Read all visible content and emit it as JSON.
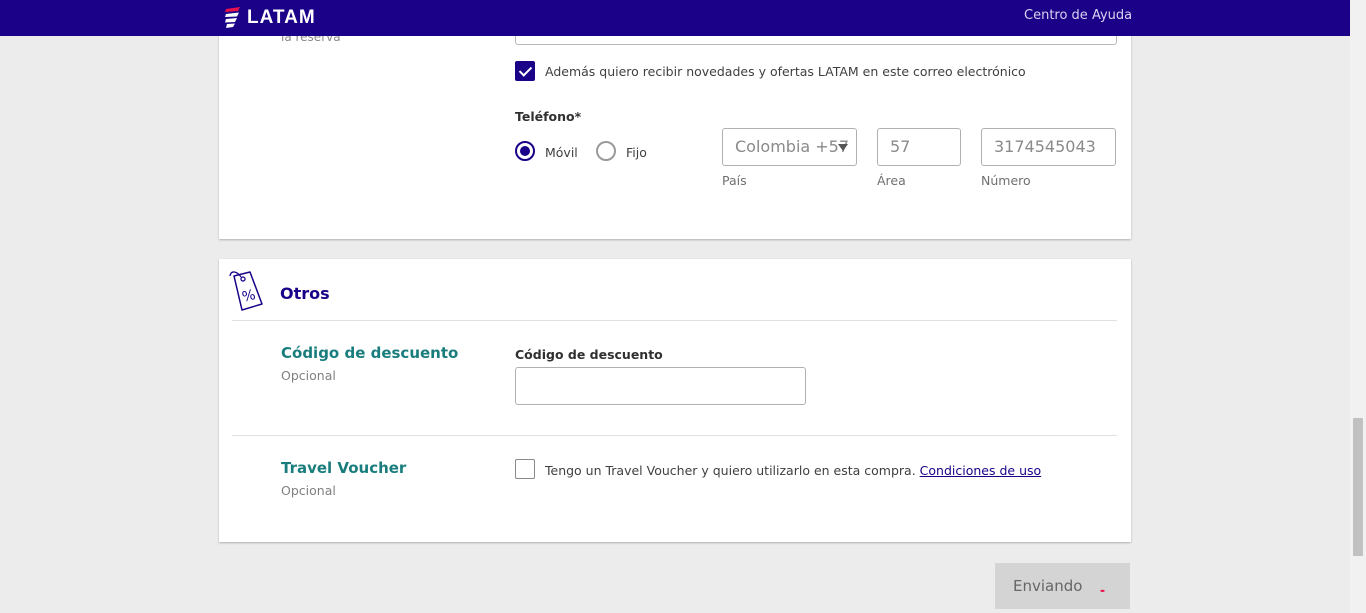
{
  "header": {
    "logo_text": "LATAM",
    "help_link": "Centro de Ayuda",
    "bg_color": "#1b0088"
  },
  "contact": {
    "reservation_hint": "la reserva",
    "newsletter_checked": true,
    "newsletter_label": "Además quiero recibir novedades y ofertas LATAM en este correo electrónico",
    "phone_label": "Teléfono*",
    "phone_type_mobile": "Móvil",
    "phone_type_fixed": "Fijo",
    "phone_type_selected": "Móvil",
    "country_value": "Colombia +57",
    "country_caption": "País",
    "area_value": "57",
    "area_caption": "Área",
    "number_value": "3174545043",
    "number_caption": "Número"
  },
  "otros": {
    "title": "Otros",
    "icon": "discount-tag-icon",
    "discount_title": "Código de descuento",
    "discount_optional": "Opcional",
    "discount_field_label": "Código de descuento",
    "discount_value": "",
    "voucher_title": "Travel Voucher",
    "voucher_optional": "Opcional",
    "voucher_checked": false,
    "voucher_label": "Tengo un Travel Voucher y quiero utilizarlo en esta compra.",
    "voucher_link": "Condiciones de uso"
  },
  "footer": {
    "submit_label": "Enviando",
    "spinner_color": "#e8114b"
  },
  "colors": {
    "brand": "#1b0088",
    "teal": "#1a7d7d"
  }
}
